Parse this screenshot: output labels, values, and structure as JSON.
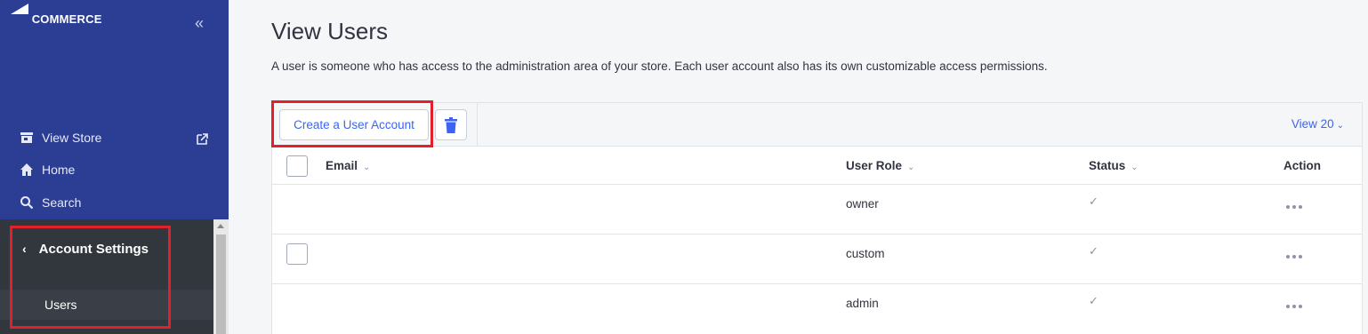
{
  "sidebar": {
    "logo": {
      "big": "BIG",
      "rest": "COMMERCE"
    },
    "collapse_icon": "«",
    "nav": [
      {
        "label": "View Store",
        "icon": "store-icon"
      },
      {
        "label": "Home",
        "icon": "home-icon"
      },
      {
        "label": "Search",
        "icon": "search-icon"
      }
    ],
    "sub_menu": {
      "back_icon": "‹",
      "title": "Account Settings",
      "items": [
        {
          "label": "Users"
        }
      ]
    },
    "colors": {
      "bg": "#2c3e94",
      "sub_bg": "#32363d"
    }
  },
  "main": {
    "title": "View Users",
    "description": "A user is someone who has access to the administration area of your store. Each user account also has its own customizable access permissions.",
    "toolbar": {
      "create_label": "Create a User Account",
      "delete_icon": "trash-icon",
      "view_label": "View 20"
    },
    "table": {
      "columns": [
        "Email",
        "User Role",
        "Status",
        "Action"
      ],
      "rows": [
        {
          "email": "",
          "role": "owner",
          "status": "✓",
          "has_checkbox": false
        },
        {
          "email": "",
          "role": "custom",
          "status": "✓",
          "has_checkbox": true
        },
        {
          "email": "",
          "role": "admin",
          "status": "✓",
          "has_checkbox": false
        }
      ]
    },
    "colors": {
      "accent": "#3c64f4",
      "highlight": "#e0202a"
    }
  }
}
